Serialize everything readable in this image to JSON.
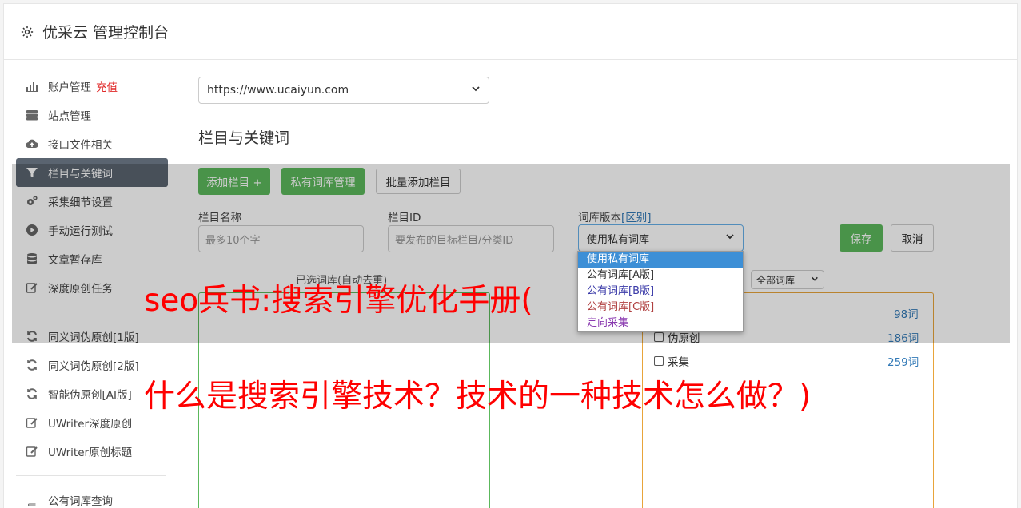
{
  "header": {
    "title": "优采云 管理控制台"
  },
  "sidebar": {
    "items": [
      {
        "label": "账户管理",
        "badge": "充值"
      },
      {
        "label": "站点管理"
      },
      {
        "label": "接口文件相关"
      },
      {
        "label": "栏目与关键词"
      },
      {
        "label": "采集细节设置"
      },
      {
        "label": "手动运行测试"
      },
      {
        "label": "文章暂存库"
      },
      {
        "label": "深度原创任务"
      },
      {
        "label": "同义词伪原创[1版]"
      },
      {
        "label": "同义词伪原创[2版]"
      },
      {
        "label": "智能伪原创[AI版]"
      },
      {
        "label": "UWriter深度原创"
      },
      {
        "label": "UWriter原创标题"
      },
      {
        "label": "公有词库查询"
      }
    ]
  },
  "main": {
    "site_select": "https://www.ucaiyun.com",
    "section_title": "栏目与关键词",
    "buttons": {
      "add_column": "添加栏目 +",
      "private_lib": "私有词库管理",
      "batch_add": "批量添加栏目",
      "save": "保存",
      "cancel": "取消"
    },
    "fields": {
      "name_label": "栏目名称",
      "name_placeholder": "最多10个字",
      "id_label": "栏目ID",
      "id_placeholder": "要发布的目标栏目/分类ID",
      "version_label": "词库版本",
      "version_link": "[区别]",
      "version_value": "使用私有词库"
    },
    "dropdown_options": [
      "使用私有词库",
      "公有词库[A版]",
      "公有词库[B版]",
      "公有词库[C版]",
      "定向采集"
    ],
    "selected_words_label": "已选词库(自动去重)",
    "filter_select": "全部词库",
    "library_list": [
      {
        "label": "",
        "count": "98词"
      },
      {
        "label": "伪原创",
        "count": "186词"
      },
      {
        "label": "采集",
        "count": "259词"
      }
    ]
  },
  "overlay": {
    "line1": "seo兵书:搜索引擎优化手册(",
    "line2": "什么是搜索引擎技术？技术的一种技术怎么做？)"
  },
  "colors": {
    "accent_green": "#5cb85c",
    "active_nav": "#5a6470",
    "recharge_red": "#e02a2a",
    "overlay_red": "#ff0000"
  }
}
